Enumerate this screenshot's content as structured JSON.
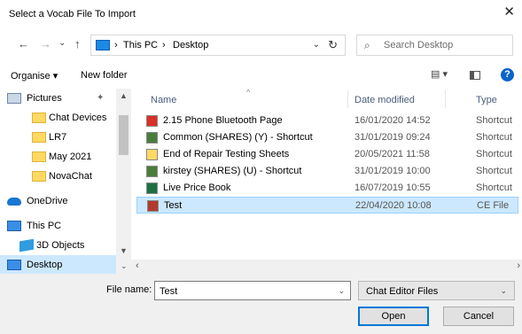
{
  "window": {
    "title": "Select a Vocab File To Import",
    "close": "✕"
  },
  "nav_buttons": {
    "back": "←",
    "forward": "→",
    "recent": "⌄",
    "up": "↑"
  },
  "address": {
    "path": [
      "This PC",
      "Desktop"
    ],
    "sep": "›",
    "dropdown": "⌄",
    "refresh": "↻"
  },
  "search": {
    "placeholder": "Search Desktop",
    "icon": "⌕"
  },
  "toolbar": {
    "organise": "Organise ▾",
    "new_folder": "New folder",
    "view_icon": "▤ ▾",
    "help": "?"
  },
  "sidebar": {
    "items": [
      {
        "label": "Pictures",
        "icon": "pictures-icon"
      },
      {
        "label": "Chat Devices",
        "icon": "folder-icon"
      },
      {
        "label": "LR7",
        "icon": "folder-icon"
      },
      {
        "label": "May 2021",
        "icon": "folder-icon"
      },
      {
        "label": "NovaChat",
        "icon": "folder-icon"
      },
      {
        "label": "OneDrive",
        "icon": "cloud-icon"
      },
      {
        "label": "This PC",
        "icon": "pc-icon"
      },
      {
        "label": "3D Objects",
        "icon": "3d-objects-icon"
      },
      {
        "label": "Desktop",
        "icon": "desktop-icon",
        "selected": true
      }
    ]
  },
  "columns": {
    "name": "Name",
    "date": "Date modified",
    "type": "Type",
    "sort": "^"
  },
  "files": [
    {
      "name": "2.15 Phone Bluetooth Page",
      "date": "16/01/2020 14:52",
      "type": "Shortcut",
      "icon": "pdf-shortcut-icon",
      "color": "#d93025"
    },
    {
      "name": "Common (SHARES) (Y) - Shortcut",
      "date": "31/01/2019 09:24",
      "type": "Shortcut",
      "icon": "network-shortcut-icon",
      "color": "#4a7d3c"
    },
    {
      "name": "End of Repair Testing Sheets",
      "date": "20/05/2021 11:58",
      "type": "Shortcut",
      "icon": "folder-shortcut-icon",
      "color": "#ffd964"
    },
    {
      "name": "kirstey (SHARES) (U) - Shortcut",
      "date": "31/01/2019 10:00",
      "type": "Shortcut",
      "icon": "network-shortcut-icon",
      "color": "#4a7d3c"
    },
    {
      "name": "Live Price Book",
      "date": "16/07/2019 10:55",
      "type": "Shortcut",
      "icon": "excel-shortcut-icon",
      "color": "#1e7145"
    },
    {
      "name": "Test",
      "date": "22/04/2020 10:08",
      "type": "CE File",
      "icon": "ce-file-icon",
      "color": "#b03a2e",
      "selected": true
    }
  ],
  "bottom": {
    "file_name_label": "File name:",
    "file_name_value": "Test",
    "file_type": "Chat Editor Files",
    "open": "Open",
    "cancel": "Cancel"
  }
}
